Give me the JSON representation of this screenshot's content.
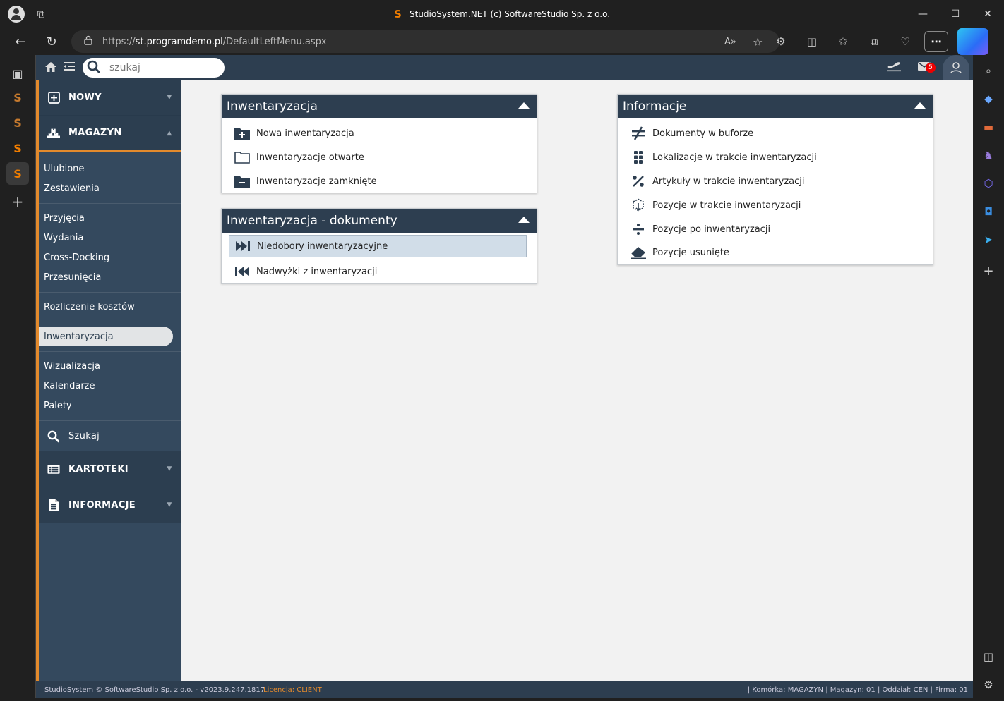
{
  "browser": {
    "window_title": "StudioSystem.NET (c) SoftwareStudio Sp. z o.o.",
    "url_scheme": "https://",
    "url_host": "st.programdemo.pl",
    "url_path": "/DefaultLeftMenu.aspx"
  },
  "topbar": {
    "search_placeholder": "szukaj",
    "mail_count": "5"
  },
  "leftmenu": {
    "new_label": "NOWY",
    "warehouse_label": "MAGAZYN",
    "groups": [
      [
        "Ulubione",
        "Zestawienia"
      ],
      [
        "Przyjęcia",
        "Wydania",
        "Cross-Docking",
        "Przesunięcia"
      ],
      [
        "Rozliczenie kosztów"
      ],
      [
        "Inwentaryzacja"
      ],
      [
        "Wizualizacja",
        "Kalendarze",
        "Palety"
      ]
    ],
    "search_label": "Szukaj",
    "cards_label": "KARTOTEKI",
    "info_label": "INFORMACJE",
    "active_item": "Inwentaryzacja"
  },
  "panels": {
    "inventory": {
      "title": "Inwentaryzacja",
      "items": [
        "Nowa inwentaryzacja",
        "Inwentaryzacje otwarte",
        "Inwentaryzacje zamknięte"
      ]
    },
    "documents": {
      "title": "Inwentaryzacja - dokumenty",
      "items": [
        "Niedobory inwentaryzacyjne",
        "Nadwyżki z inwentaryzacji"
      ]
    },
    "info": {
      "title": "Informacje",
      "items": [
        "Dokumenty w buforze",
        "Lokalizacje w trakcie inwentaryzacji",
        "Artykuły w trakcie inwentaryzacji",
        "Pozycje w trakcie inwentaryzacji",
        "Pozycje po inwentaryzacji",
        "Pozycje usunięte"
      ]
    }
  },
  "footer": {
    "copyright": "StudioSystem © SoftwareStudio Sp. z o.o. - v2023.9.247.1817",
    "license": "Licencja: CLIENT",
    "context": "| Komórka: MAGAZYN | Magazyn: 01 | Oddział: CEN | Firma: 01"
  },
  "colors": {
    "app_dark": "#2d3e50",
    "menu_bg": "#34495e",
    "accent": "#e38a2c",
    "highlight": "#d1dde8"
  }
}
